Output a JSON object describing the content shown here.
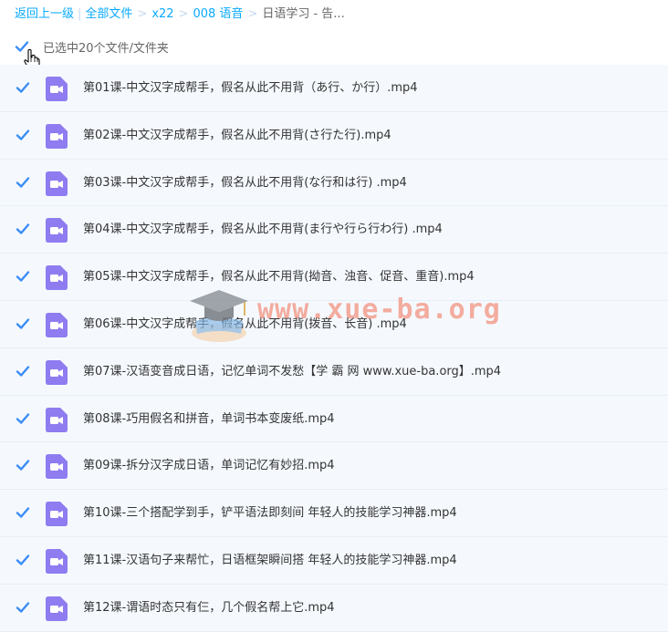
{
  "breadcrumb": {
    "back": "返回上一级",
    "items": [
      "全部文件",
      "x22",
      "008 语音"
    ],
    "current": "日语学习 - 告..."
  },
  "selection": {
    "label": "已选中20个文件/文件夹",
    "checked": true
  },
  "colors": {
    "accent": "#09aaff",
    "check": "#3b8cf6",
    "video_icon": "#8e7cf0",
    "row_bg": "#f5f9fe"
  },
  "files": [
    {
      "name": "第01课-中文汉字成帮手，假名从此不用背（あ行、か行）.mp4",
      "icon": "video-file-icon",
      "checked": true
    },
    {
      "name": "第02课-中文汉字成帮手，假名从此不用背(さ行た行).mp4",
      "icon": "video-file-icon",
      "checked": true
    },
    {
      "name": "第03课-中文汉字成帮手，假名从此不用背(な行和は行) .mp4",
      "icon": "video-file-icon",
      "checked": true
    },
    {
      "name": "第04课-中文汉字成帮手，假名从此不用背(ま行や行ら行わ行) .mp4",
      "icon": "video-file-icon",
      "checked": true
    },
    {
      "name": "第05课-中文汉字成帮手，假名从此不用背(拗音、浊音、促音、重音).mp4",
      "icon": "video-file-icon",
      "checked": true
    },
    {
      "name": "第06课-中文汉字成帮手，假名从此不用背(拨音、长音) .mp4",
      "icon": "video-file-icon",
      "checked": true
    },
    {
      "name": "第07课-汉语变音成日语，记忆单词不发愁【学 霸 网 www.xue-ba.org】.mp4",
      "icon": "video-file-icon",
      "checked": true
    },
    {
      "name": "第08课-巧用假名和拼音，单词书本变废纸.mp4",
      "icon": "video-file-icon",
      "checked": true
    },
    {
      "name": "第09课-拆分汉字成日语，单词记忆有妙招.mp4",
      "icon": "video-file-icon",
      "checked": true
    },
    {
      "name": "第10课-三个搭配学到手，铲平语法即刻间 年轻人的技能学习神器.mp4",
      "icon": "video-file-icon",
      "checked": true
    },
    {
      "name": "第11课-汉语句子来帮忙，日语框架瞬间搭 年轻人的技能学习神器.mp4",
      "icon": "video-file-icon",
      "checked": true
    },
    {
      "name": "第12课-谓语时态只有仨，几个假名帮上它.mp4",
      "icon": "video-file-icon",
      "checked": true
    }
  ],
  "watermark": {
    "text": "www.xue-ba.org"
  }
}
